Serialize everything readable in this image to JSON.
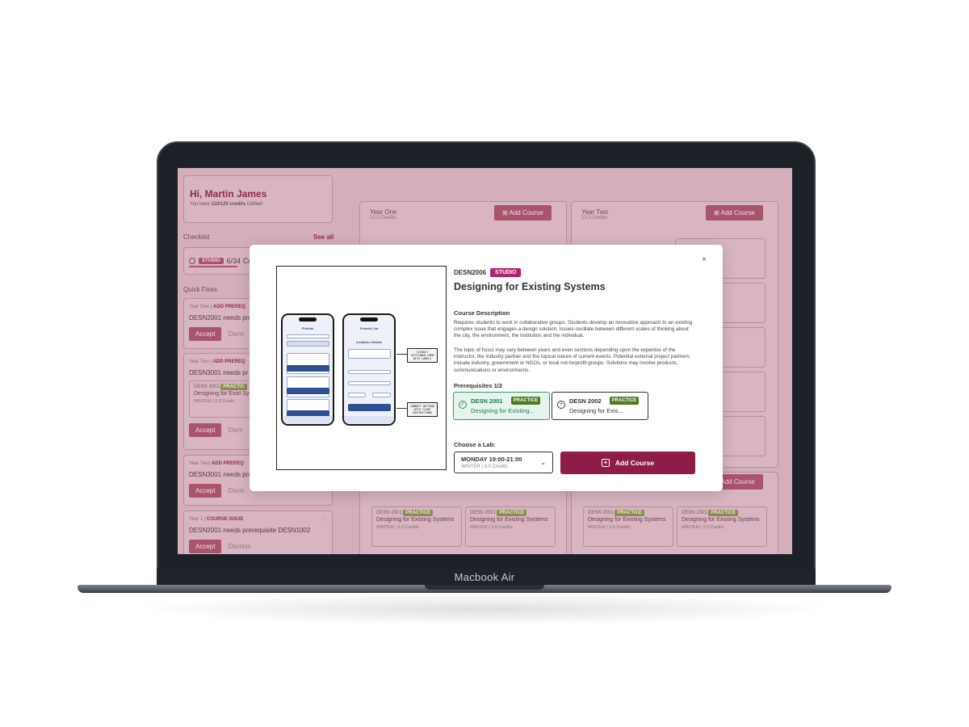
{
  "device": {
    "label": "Macbook Air"
  },
  "sidebar": {
    "greeting_prefix": "Hi, ",
    "user_name": "Martin James",
    "credits_prefix": "You have ",
    "credits_value": "110/120 credits",
    "credits_suffix": " fulfilled",
    "checklist_title": "Checklist",
    "checklist_see_all": "See all",
    "checklist_item": {
      "badge": "STUDIO",
      "text": "6/34 Cre"
    },
    "quick_fixes_title": "Quick Fixes",
    "quick_fixes": [
      {
        "year": "Year One | ",
        "type": "ADD PREREQ",
        "message": "DESN2001 needs pre",
        "accept": "Accept",
        "dismiss": "Dismi"
      },
      {
        "year": "Year Two | ",
        "type": "ADD PREREQ",
        "message": "DESN3001 needs pr",
        "inner_code": "DESN 2001",
        "inner_badge": "PRACTIC",
        "inner_name": "Designing for Exist Systems",
        "inner_credits": "WINTER | 3.0 Credit",
        "accept": "Accept",
        "dismiss": "Dism"
      },
      {
        "year": "Year Two| ",
        "type": "ADD PREREQ",
        "message": "DESN3001 needs pre",
        "accept": "Accept",
        "dismiss": "Dismi"
      },
      {
        "year": "Year 1 | ",
        "type": "COURSE ISSUE",
        "message": "DESN2001 needs prerequisite DESN1002",
        "accept": "Accept",
        "dismiss": "Dismiss"
      }
    ]
  },
  "years": [
    {
      "title": "Year One",
      "credits": "12.0 Credits",
      "add_label": "Add Course"
    },
    {
      "title": "Year Two",
      "credits": "12.0 Credits",
      "add_label": "Add Course"
    }
  ],
  "background_cards": {
    "code": "DESN 2001",
    "badge": "PRACTICE",
    "name": "Designing for Existing Systems",
    "credits": "WINTER | 3.0 Credits",
    "partial_name": "Existing",
    "partial_credits": "dits",
    "lower_add_label": "Add Course"
  },
  "modal": {
    "close": "×",
    "code": "DESN2006",
    "badge": "STUDIO",
    "title": "Designing for Existing Systems",
    "description_heading": "Course Description",
    "description_p1": "Requires students to work in collaborative groups. Students develop an innovative approach to an existing complex issue that engages a design solution. Issues oscillate between different scales of thinking about the city, the environment, the institution and the individual.",
    "description_p2": "The topic of focus may vary between years and even sections depending upon the expertise of the instructor, the industry partner and the topical nature of current events. Potential external project partners include industry, government or NGOs, or local not-forprofit groups. Solutions may involve products, communications or environments.",
    "prerequisites_heading": "Prerequisites 1/2",
    "prerequisites": [
      {
        "code": "DESN 2001",
        "badge": "PRACTICE",
        "name": "Designing for Existing...",
        "status": "done"
      },
      {
        "code": "DESN 2002",
        "badge": "PRACTICE",
        "name": "Designing for Exis...",
        "status": "todo"
      }
    ],
    "lab_heading": "Choose a Lab:",
    "lab_selected": "MONDAY 19:00-21:00",
    "lab_sub": "WINTER | 3.0 Credits",
    "add_button": "Add Course",
    "preview": {
      "phone1_title": "Friends",
      "phone2_title": "Friends List",
      "phone2_section": "Invitation Details",
      "callout1": "CLEARLY SECTIONED FORM WITH LABELS",
      "callout2": "CONNECT BUTTONS WITH CLEAR INSTRUCTIONS"
    }
  }
}
